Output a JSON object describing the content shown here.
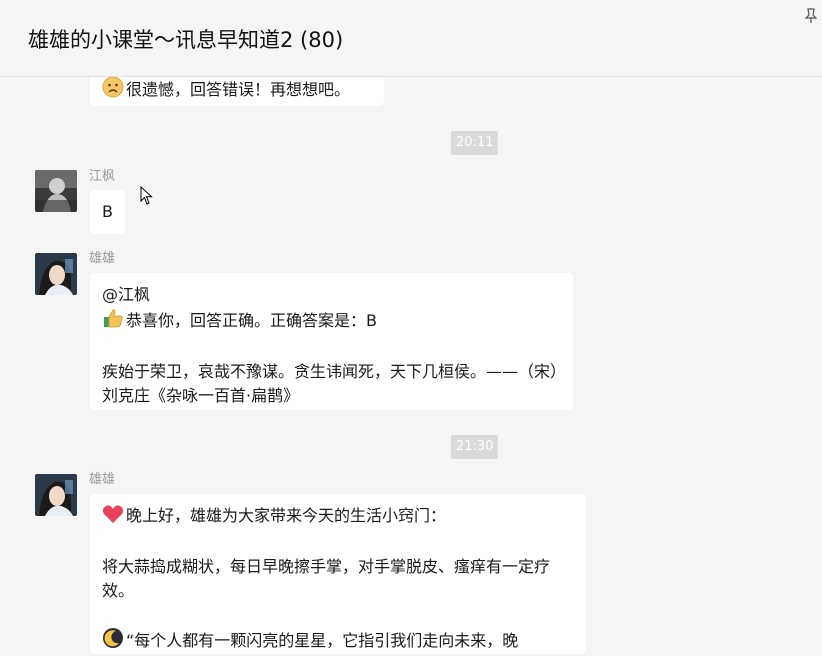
{
  "header": {
    "title": "雄雄的小课堂～讯息早知道2 (80)"
  },
  "messages": {
    "m0": {
      "text": "很遗憾，回答错误！再想想吧。"
    },
    "t1": {
      "time": "20:11"
    },
    "m1": {
      "sender": "江枫",
      "text": "B"
    },
    "m2": {
      "sender": "雄雄",
      "line1": "@江枫",
      "line2": "恭喜你，回答正确。正确答案是：B",
      "line3": "疾始于荣卫，哀哉不豫谋。贪生讳闻死，天下几桓侯。——（宋）刘克庄《杂咏一百首·扁鹊》"
    },
    "t2": {
      "time": "21:30"
    },
    "m3": {
      "sender": "雄雄",
      "line1": "晚上好，雄雄为大家带来今天的生活小窍门：",
      "line2": "将大蒜捣成糊状，每日早晚擦手掌，对手掌脱皮、瘙痒有一定疗效。",
      "line3": "“每个人都有一颗闪亮的星星，它指引我们走向未来，晚"
    }
  },
  "colors": {
    "background": "#f5f5f5",
    "bubble": "#ffffff",
    "timestamp_bg": "#dadada",
    "sender_text": "#9a9a9a"
  },
  "icons": [
    "pin-icon",
    "sad-face-emoji",
    "thumbs-up-emoji",
    "heart-emoji",
    "moon-emoji",
    "mouse-cursor-icon"
  ]
}
